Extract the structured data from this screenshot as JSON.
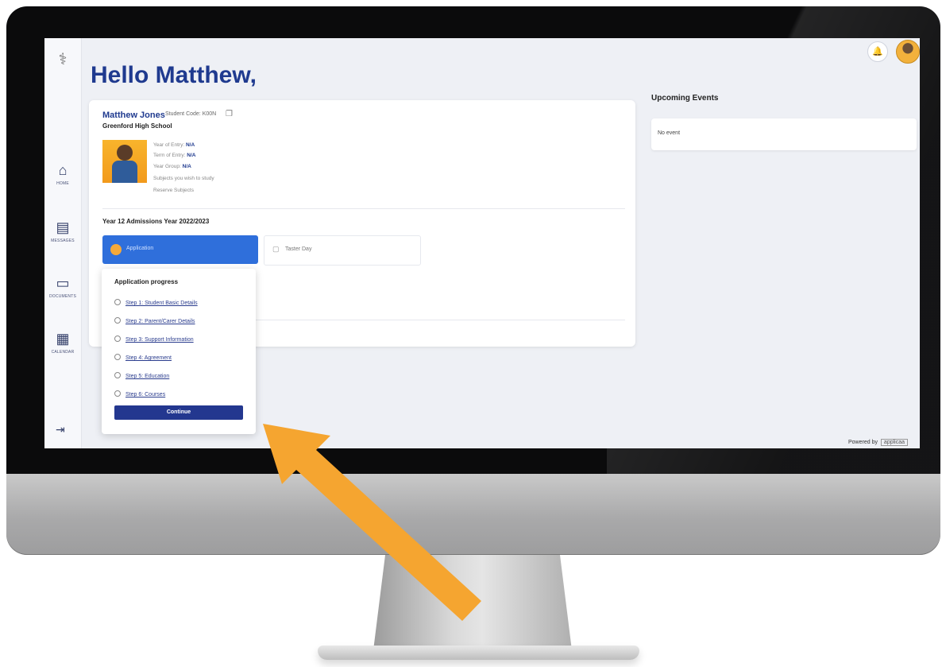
{
  "header": {
    "greeting": "Hello Matthew,"
  },
  "student": {
    "name": "Matthew Jones",
    "code_label": "Student Code: K00N",
    "school": "Greenford High School",
    "year_of_entry_label": "Year of Entry:",
    "year_of_entry_value": "N/A",
    "term_of_entry_label": "Term of Entry:",
    "term_of_entry_value": "N/A",
    "year_group_label": "Year Group:",
    "year_group_value": "N/A",
    "subjects_label": "Subjects you wish to study",
    "reserve_label": "Reserve Subjects"
  },
  "admissions": {
    "title": "Year 12 Admissions Year 2022/2023",
    "tabs": [
      {
        "label": "Application"
      },
      {
        "label": "Taster Day"
      }
    ]
  },
  "progress": {
    "title": "Application progress",
    "steps": [
      "Step 1: Student Basic Details",
      "Step 2: Parent/Carer Details",
      "Step 3: Support Information",
      "Step 4: Agreement",
      "Step 5: Education",
      "Step 6: Courses"
    ],
    "continue_label": "Continue"
  },
  "sidebar": {
    "items": [
      {
        "label": "HOME",
        "icon": "home-icon"
      },
      {
        "label": "MESSAGES",
        "icon": "message-icon"
      },
      {
        "label": "DOCUMENTS",
        "icon": "folder-icon"
      },
      {
        "label": "CALENDAR",
        "icon": "calendar-icon"
      }
    ]
  },
  "events": {
    "title": "Upcoming Events",
    "empty": "No event"
  },
  "footer": {
    "powered_by": "Powered by",
    "brand": "applicaa"
  },
  "colors": {
    "accent": "#1f3a8f",
    "tab_active": "#2f6fdb",
    "arrow": "#f5a530"
  }
}
